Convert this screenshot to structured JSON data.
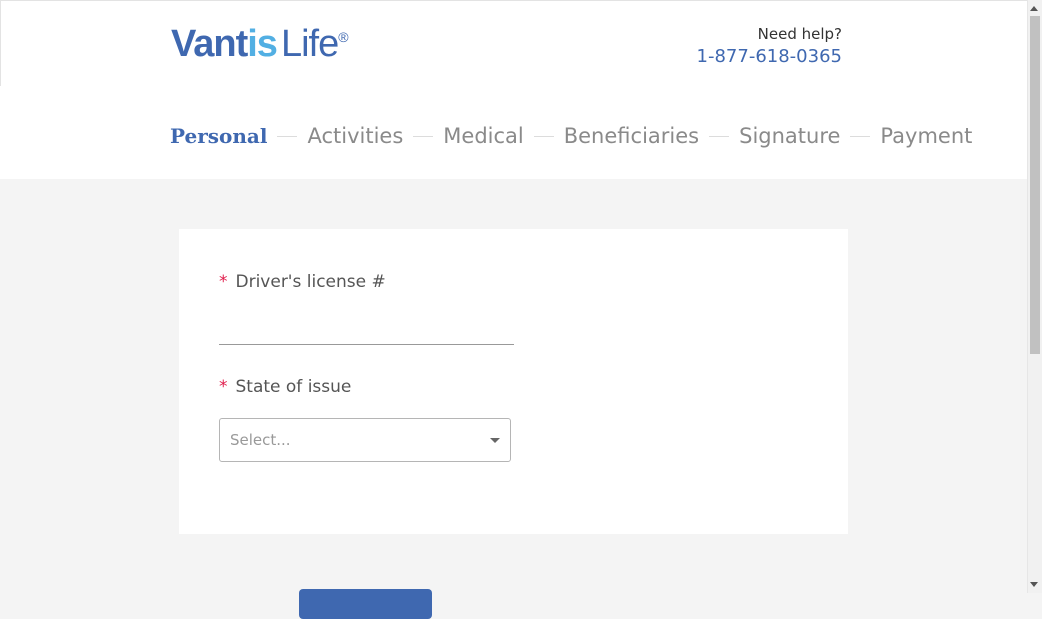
{
  "brand": {
    "logo_part1": "Vantis",
    "logo_part2": "Life",
    "logo_reg": "®"
  },
  "help": {
    "label": "Need help?",
    "phone": "1-877-618-0365"
  },
  "steps": [
    {
      "label": "Personal",
      "active": true
    },
    {
      "label": "Activities",
      "active": false
    },
    {
      "label": "Medical",
      "active": false
    },
    {
      "label": "Beneficiaries",
      "active": false
    },
    {
      "label": "Signature",
      "active": false
    },
    {
      "label": "Payment",
      "active": false
    }
  ],
  "form": {
    "required_mark": "*",
    "license_label": "Driver's license #",
    "license_value": "",
    "state_label": "State of issue",
    "state_placeholder": "Select..."
  },
  "colors": {
    "primary": "#3f68b0",
    "accent": "#52afe3",
    "required": "#e01e4c",
    "inactive_step": "#8a8a8a"
  }
}
